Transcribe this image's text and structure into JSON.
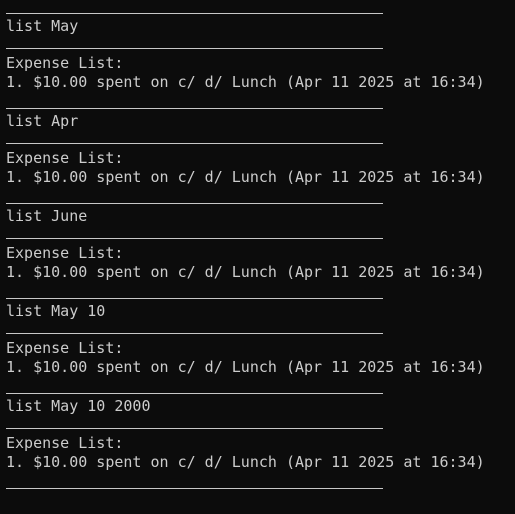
{
  "terminal": {
    "blocks": [
      {
        "command": "list May",
        "header": "Expense List:",
        "entry": "1. $10.00 spent on c/ d/ Lunch (Apr 11 2025 at 16:34)"
      },
      {
        "command": "list Apr",
        "header": "Expense List:",
        "entry": "1. $10.00 spent on c/ d/ Lunch (Apr 11 2025 at 16:34)"
      },
      {
        "command": "list June",
        "header": "Expense List:",
        "entry": "1. $10.00 spent on c/ d/ Lunch (Apr 11 2025 at 16:34)"
      },
      {
        "command": "list May 10",
        "header": "Expense List:",
        "entry": "1. $10.00 spent on c/ d/ Lunch (Apr 11 2025 at 16:34)"
      },
      {
        "command": "list May 10 2000",
        "header": "Expense List:",
        "entry": "1. $10.00 spent on c/ d/ Lunch (Apr 11 2025 at 16:34)"
      }
    ]
  },
  "colors": {
    "background": "#0c0c0c",
    "foreground": "#cccccc"
  }
}
